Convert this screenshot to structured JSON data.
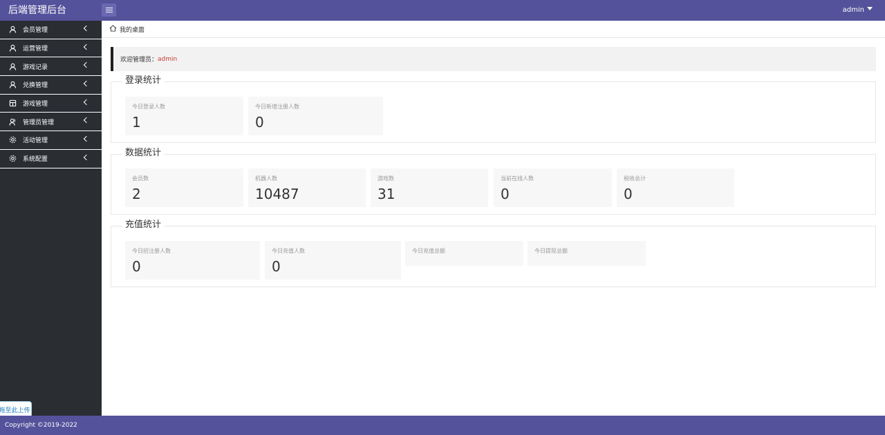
{
  "header": {
    "brand": "后端管理后台",
    "user": "admin"
  },
  "sidebar": {
    "items": [
      {
        "label": "会员管理",
        "icon": "user-icon"
      },
      {
        "label": "运营管理",
        "icon": "user-icon"
      },
      {
        "label": "游戏记录",
        "icon": "user-icon"
      },
      {
        "label": "兑换管理",
        "icon": "user-icon"
      },
      {
        "label": "游戏管理",
        "icon": "database-icon"
      },
      {
        "label": "管理员管理",
        "icon": "users-icon"
      },
      {
        "label": "活动管理",
        "icon": "gear-icon"
      },
      {
        "label": "系统配置",
        "icon": "gear-icon"
      }
    ],
    "upload_button": "拖至此上传"
  },
  "breadcrumb": {
    "label": "我的桌面"
  },
  "welcome": {
    "prefix": "欢迎管理员：",
    "name": "admin"
  },
  "sections": {
    "login": {
      "title": "登录统计",
      "cards": [
        {
          "label": "今日登录人数",
          "value": "1"
        },
        {
          "label": "今日新增注册人数",
          "value": "0"
        }
      ]
    },
    "data": {
      "title": "数据统计",
      "cards": [
        {
          "label": "会员数",
          "value": "2"
        },
        {
          "label": "机器人数",
          "value": "10487"
        },
        {
          "label": "游戏数",
          "value": "31"
        },
        {
          "label": "当前在线人数",
          "value": "0"
        },
        {
          "label": "税收总计",
          "value": "0"
        }
      ]
    },
    "recharge": {
      "title": "充值统计",
      "cards": [
        {
          "label": "今日招注册人数",
          "value": "0"
        },
        {
          "label": "今日充值人数",
          "value": "0"
        },
        {
          "label": "今日充值总额",
          "value": ""
        },
        {
          "label": "今日提现总额",
          "value": ""
        }
      ]
    }
  },
  "footer": {
    "copyright": "Copyright ©2019-2022"
  },
  "colors": {
    "header_bg": "#54529b",
    "sidebar_bg": "#2a2e33",
    "card_bg": "#f7f7f7",
    "welcome_name": "#c0392b"
  }
}
